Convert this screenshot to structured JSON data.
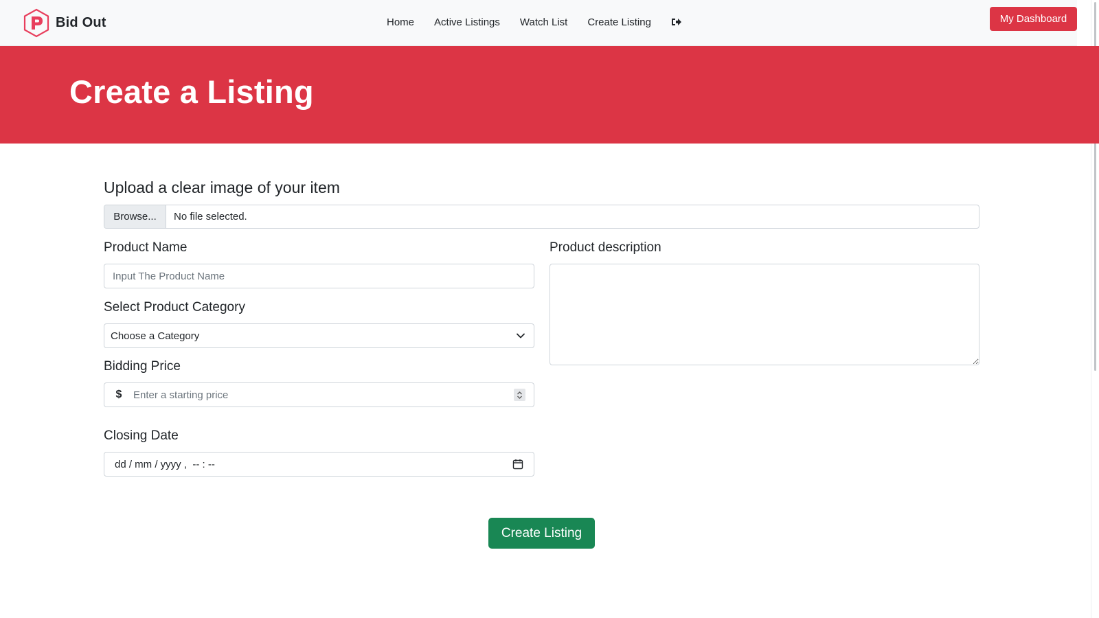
{
  "brand": {
    "name": "Bid Out",
    "logo_icon": "bid-out-hexagon-logo",
    "accent": "#e83e5c"
  },
  "nav": {
    "links": [
      {
        "label": "Home"
      },
      {
        "label": "Active Listings"
      },
      {
        "label": "Watch List"
      },
      {
        "label": "Create Listing"
      }
    ],
    "logout_icon": "sign-out-icon",
    "dashboard_label": "My Dashboard"
  },
  "hero": {
    "title": "Create a Listing",
    "color": "#dc3545"
  },
  "form": {
    "upload_label": "Upload a clear image of your item",
    "browse_label": "Browse...",
    "file_status": "No file selected.",
    "product_name_label": "Product Name",
    "product_name_placeholder": "Input The Product Name",
    "category_label": "Select Product Category",
    "category_selected": "Choose a Category",
    "price_label": "Bidding Price",
    "currency_symbol": "$",
    "price_placeholder": "Enter a starting price",
    "closing_label": "Closing Date",
    "closing_placeholder": "dd / mm / yyyy ,  -- : --",
    "description_label": "Product description",
    "submit_label": "Create Listing",
    "submit_color": "#198754"
  }
}
